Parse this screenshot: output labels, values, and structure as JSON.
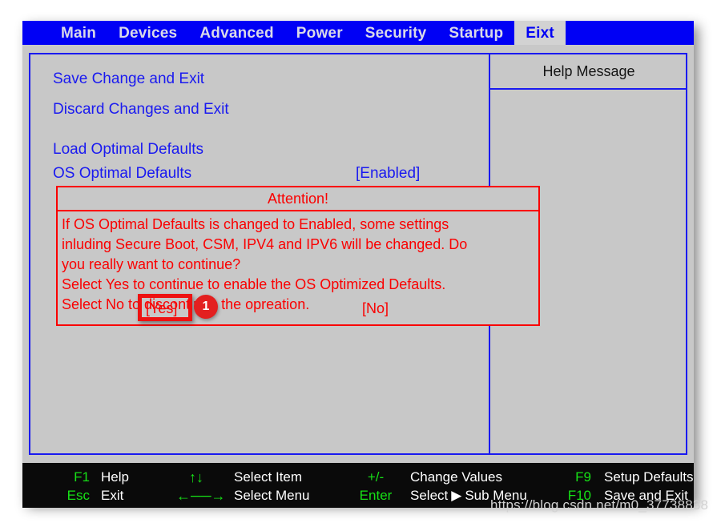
{
  "menu": {
    "tabs": [
      {
        "label": "Main",
        "active": false
      },
      {
        "label": "Devices",
        "active": false
      },
      {
        "label": "Advanced",
        "active": false
      },
      {
        "label": "Power",
        "active": false
      },
      {
        "label": "Security",
        "active": false
      },
      {
        "label": "Startup",
        "active": false
      },
      {
        "label": "Eixt",
        "active": true
      }
    ]
  },
  "settings": [
    {
      "label": "Save Change and Exit",
      "value": ""
    },
    {
      "label": "Discard Changes and Exit",
      "value": ""
    },
    {
      "label": "Load Optimal Defaults",
      "value": ""
    },
    {
      "label": "OS Optimal Defaults",
      "value": "[Enabled]"
    }
  ],
  "help": {
    "title": "Help Message",
    "body": ""
  },
  "dialog": {
    "title": "Attention!",
    "lines": [
      "If OS Optimal Defaults is changed to Enabled, some settings",
      "inluding Secure Boot, CSM, IPV4 and IPV6 will be changed. Do",
      "you really want to continue?",
      "Select Yes to continue to enable the OS Optimized Defaults.",
      "Select  No to discontinue the opreation."
    ],
    "yes_label": "[Yes]",
    "no_label": "[No]"
  },
  "annotation": {
    "step_number": "1",
    "target": "[Yes]"
  },
  "footer": {
    "columns": [
      {
        "rows": [
          {
            "key": "F1",
            "desc": "Help"
          },
          {
            "key": "Esc",
            "desc": "Exit"
          }
        ]
      },
      {
        "rows": [
          {
            "key": "↑↓",
            "desc": "Select Item"
          },
          {
            "key": "←──→",
            "desc": "Select Menu"
          }
        ]
      },
      {
        "rows": [
          {
            "key": "+/-",
            "desc": "Change Values"
          },
          {
            "key": "Enter",
            "desc_pre": "Select",
            "arrow": "▶",
            "desc_post": "Sub Menu"
          }
        ]
      },
      {
        "rows": [
          {
            "key": "F9",
            "desc": "Setup Defaults"
          },
          {
            "key": "F10",
            "desc": "Save and Exit"
          }
        ]
      }
    ]
  },
  "watermark": "https://blog.csdn.net/m0_37738838",
  "colors": {
    "menu_bar_blue": "#0000f5",
    "panel_border_blue": "#1a1af0",
    "text_blue": "#1a1af0",
    "dialog_red": "#fa0000",
    "annotation_red": "#e32020",
    "screen_gray": "#c8c8c8",
    "footer_black": "#0a0a0a",
    "footer_key_green": "#16e016"
  }
}
